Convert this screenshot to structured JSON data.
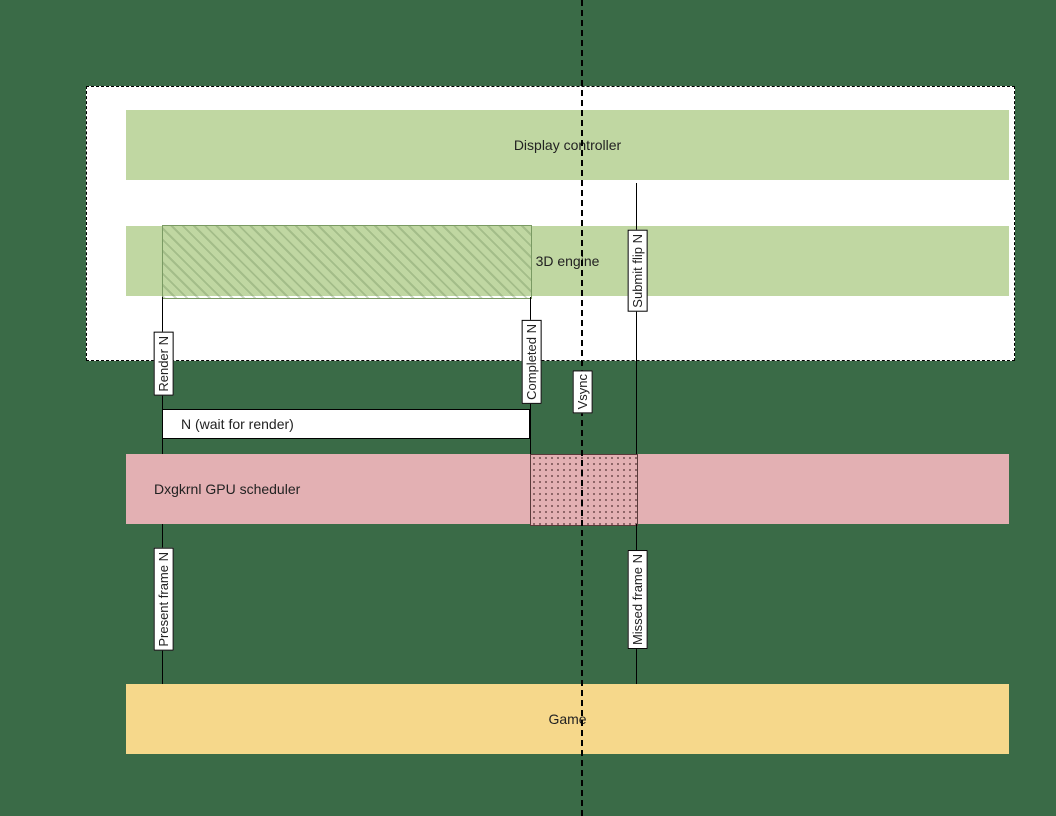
{
  "bars": {
    "display_controller": "Display controller",
    "engine": "3D engine",
    "scheduler": "Dxgkrnl GPU scheduler",
    "wait_box": "N (wait for render)",
    "game": "Game"
  },
  "lines": {
    "render": "Render N",
    "completed": "Completed N",
    "submit_flip": "Submit flip N",
    "vsync": "Vsync",
    "present_frame": "Present frame N",
    "missed_frame": "Missed frame N"
  },
  "colors": {
    "background": "#3a6b47",
    "green": "#c0d7a2",
    "pink": "#e3b0b3",
    "yellow": "#f6d88b"
  }
}
